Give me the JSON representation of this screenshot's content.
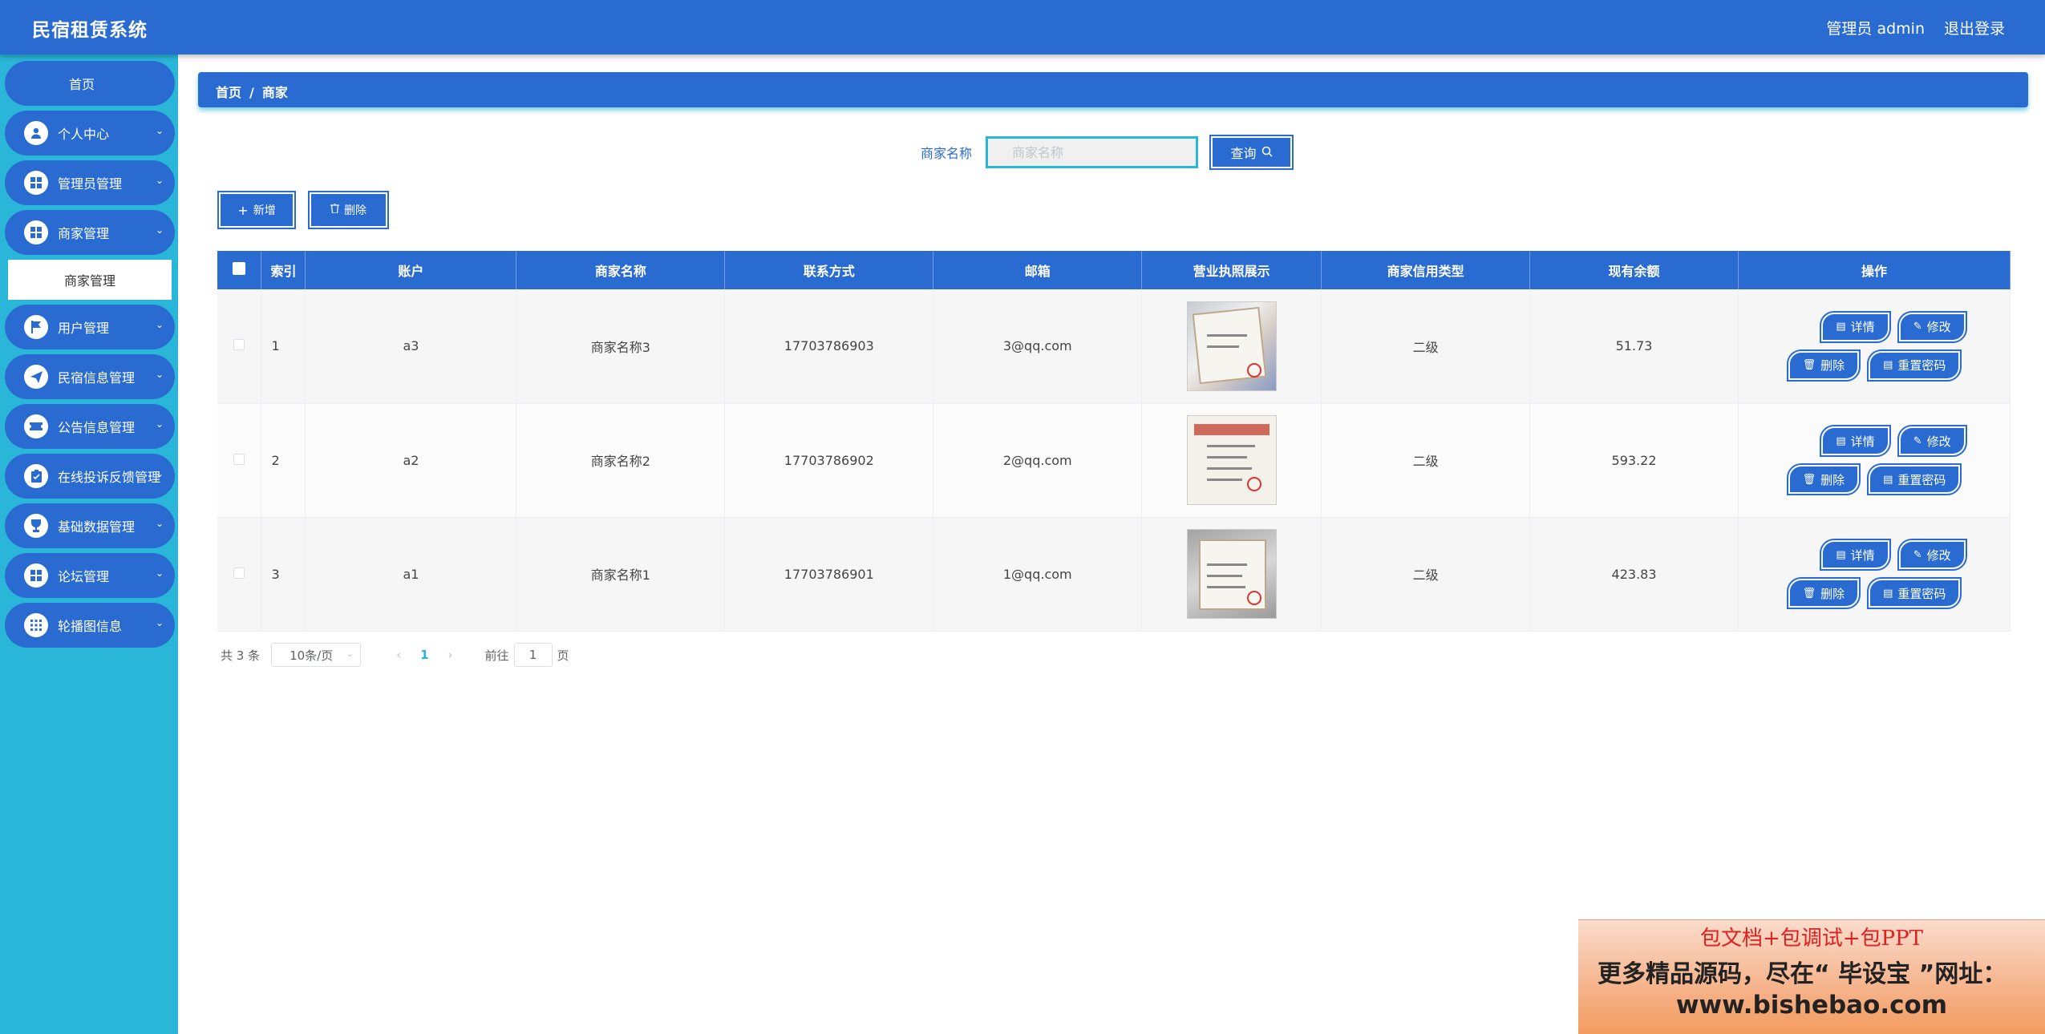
{
  "header": {
    "app_title": "民宿租赁系统",
    "user_label": "管理员 admin",
    "logout_label": "退出登录"
  },
  "sidebar": {
    "home": "首页",
    "items": [
      {
        "label": "个人中心",
        "icon": "user-icon"
      },
      {
        "label": "管理员管理",
        "icon": "grid-icon"
      },
      {
        "label": "商家管理",
        "icon": "grid-icon",
        "expanded": true,
        "sub": "商家管理"
      },
      {
        "label": "用户管理",
        "icon": "flag-icon"
      },
      {
        "label": "民宿信息管理",
        "icon": "send-icon"
      },
      {
        "label": "公告信息管理",
        "icon": "ticket-icon"
      },
      {
        "label": "在线投诉反馈管理",
        "icon": "clipboard-icon"
      },
      {
        "label": "基础数据管理",
        "icon": "goblet-icon"
      },
      {
        "label": "论坛管理",
        "icon": "grid-icon"
      },
      {
        "label": "轮播图信息",
        "icon": "apps-icon"
      }
    ]
  },
  "breadcrumb": {
    "home": "首页",
    "sep": "/",
    "current": "商家"
  },
  "search": {
    "label": "商家名称",
    "placeholder": "商家名称",
    "button": "查询"
  },
  "toolbar": {
    "add": "新增",
    "delete": "删除"
  },
  "table": {
    "headers": [
      "索引",
      "账户",
      "商家名称",
      "联系方式",
      "邮箱",
      "营业执照展示",
      "商家信用类型",
      "现有余额",
      "操作"
    ],
    "rows": [
      {
        "index": "1",
        "account": "a3",
        "name": "商家名称3",
        "phone": "17703786903",
        "email": "3@qq.com",
        "credit": "二级",
        "balance": "51.73"
      },
      {
        "index": "2",
        "account": "a2",
        "name": "商家名称2",
        "phone": "17703786902",
        "email": "2@qq.com",
        "credit": "二级",
        "balance": "593.22"
      },
      {
        "index": "3",
        "account": "a1",
        "name": "商家名称1",
        "phone": "17703786901",
        "email": "1@qq.com",
        "credit": "二级",
        "balance": "423.83"
      }
    ],
    "actions": {
      "detail": "详情",
      "edit": "修改",
      "delete": "删除",
      "reset": "重置密码"
    }
  },
  "pager": {
    "total": "共 3 条",
    "page_size": "10条/页",
    "current": "1",
    "goto": "前往",
    "goto_value": "1",
    "page_suffix": "页"
  },
  "ad": {
    "line1": "包文档+包调试+包PPT",
    "line2": "更多精品源码，尽在“ 毕设宝 ”网址：",
    "line3": "www.bishebao.com"
  },
  "colors": {
    "primary": "#2a6bd1",
    "sidebar": "#29b6d8"
  }
}
